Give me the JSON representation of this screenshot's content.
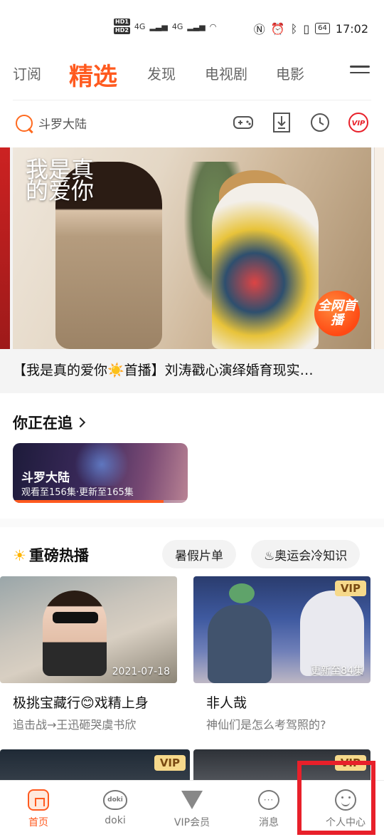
{
  "status_bar": {
    "hd1": "HD1",
    "hd2": "HD2",
    "signal1": "4G",
    "signal2": "4G",
    "battery": "64",
    "time": "17:02"
  },
  "tabs": [
    "订阅",
    "精选",
    "发现",
    "电视剧",
    "电影"
  ],
  "active_tab": "精选",
  "search": {
    "placeholder": "斗罗大陆"
  },
  "banner": {
    "show_title": "我是真的爱你",
    "badge": "全网首播",
    "caption": "【我是真的爱你☀️首播】刘涛戳心演绎婚育现实…"
  },
  "watching": {
    "section_title": "你正在追",
    "card_title": "斗罗大陆",
    "card_sub": "观看至156集·更新至165集",
    "progress": 0.86
  },
  "hot": {
    "section_title": "重磅热播",
    "pill1": "暑假片单",
    "pill2": "♨奥运会冷知识",
    "cards": [
      {
        "overlay": "2021-07-18",
        "title": "极挑宝藏行😊戏精上身",
        "sub": "追击战→王迅砸哭虞书欣",
        "vip": ""
      },
      {
        "overlay": "更新至84集",
        "title": "非人哉",
        "sub": "神仙们是怎么考驾照的?",
        "vip": "VIP"
      }
    ],
    "card3_vip": "VIP",
    "card4_vip": "VIP"
  },
  "bottom_nav": [
    {
      "label": "首页",
      "icon": "home-icon",
      "active": true
    },
    {
      "label": "doki",
      "icon": "doki-icon",
      "active": false
    },
    {
      "label": "VIP会员",
      "icon": "vip-icon",
      "active": false
    },
    {
      "label": "消息",
      "icon": "message-icon",
      "active": false
    },
    {
      "label": "个人中心",
      "icon": "profile-icon",
      "active": false
    }
  ],
  "colors": {
    "accent": "#ff5a1f",
    "highlight": "#e8202a"
  }
}
